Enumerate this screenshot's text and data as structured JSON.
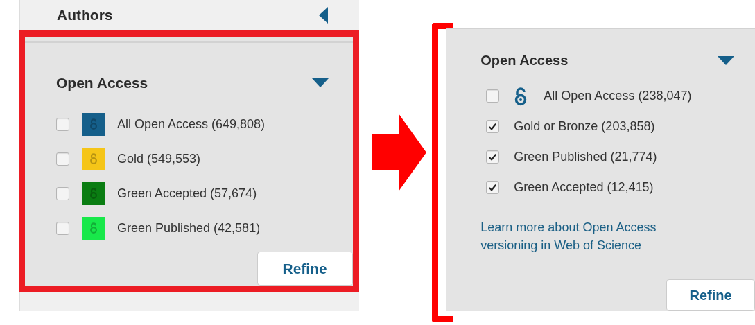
{
  "before": {
    "header": {
      "title": "Authors",
      "expanded": false
    },
    "filter": {
      "title": "Open Access",
      "expanded": true,
      "options": [
        {
          "label": "All Open Access (649,808)",
          "checked": false,
          "kind": "badge",
          "color": "#155f8a"
        },
        {
          "label": "Gold (549,553)",
          "checked": false,
          "kind": "badge",
          "color": "#f5c518"
        },
        {
          "label": "Green Accepted (57,674)",
          "checked": false,
          "kind": "badge",
          "color": "#0a7d12"
        },
        {
          "label": "Green Published (42,581)",
          "checked": false,
          "kind": "badge",
          "color": "#18e84a"
        }
      ],
      "button": "Refine"
    }
  },
  "after": {
    "filter": {
      "title": "Open Access",
      "expanded": true,
      "options": [
        {
          "label": "All Open Access (238,047)",
          "checked": false,
          "kind": "lock"
        },
        {
          "label": "Gold or Bronze (203,858)",
          "checked": true,
          "kind": "plain"
        },
        {
          "label": "Green Published (21,774)",
          "checked": true,
          "kind": "plain"
        },
        {
          "label": "Green Accepted (12,415)",
          "checked": true,
          "kind": "plain"
        }
      ],
      "link": "Learn more about Open Access versioning in Web of Science",
      "button": "Refine"
    }
  }
}
